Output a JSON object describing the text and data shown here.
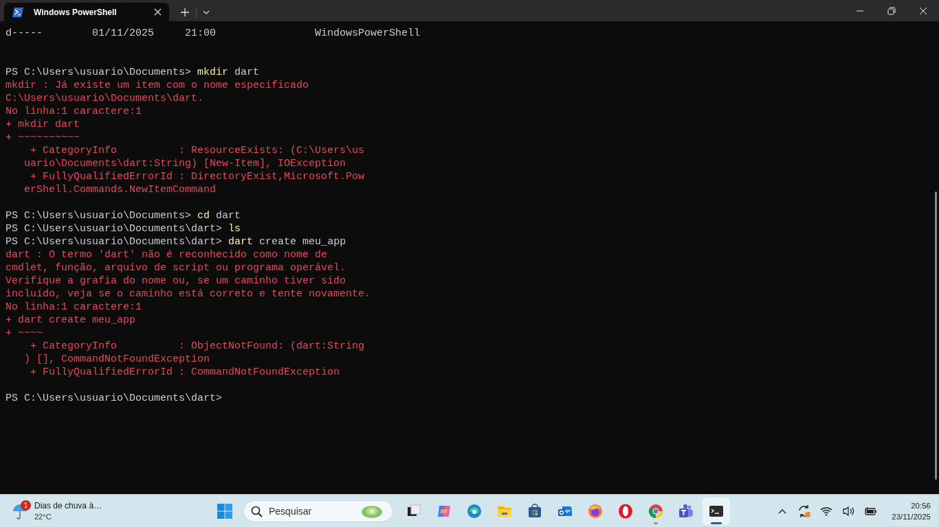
{
  "window": {
    "tabs": [
      {
        "title": "Windows PowerShell",
        "selected": true
      }
    ]
  },
  "terminal": {
    "lines": [
      {
        "kind": "output",
        "text": "d-----        01/11/2025     21:00                WindowsPowerShell"
      },
      {
        "kind": "blank"
      },
      {
        "kind": "blank"
      },
      {
        "kind": "prompt",
        "prompt": "PS C:\\Users\\usuario\\Documents>",
        "command": "mkdir",
        "args": "dart"
      },
      {
        "kind": "error",
        "text": "mkdir : Já existe um item com o nome especificado"
      },
      {
        "kind": "error",
        "text": "C:\\Users\\usuario\\Documents\\dart."
      },
      {
        "kind": "error",
        "text": "No linha:1 caractere:1"
      },
      {
        "kind": "error",
        "text": "+ mkdir dart"
      },
      {
        "kind": "error",
        "text": "+ ~~~~~~~~~~"
      },
      {
        "kind": "error",
        "text": "    + CategoryInfo          : ResourceExists: (C:\\Users\\us"
      },
      {
        "kind": "error",
        "text": "   uario\\Documents\\dart:String) [New-Item], IOException"
      },
      {
        "kind": "error",
        "text": "    + FullyQualifiedErrorId : DirectoryExist,Microsoft.Pow"
      },
      {
        "kind": "error",
        "text": "   erShell.Commands.NewItemCommand"
      },
      {
        "kind": "blank"
      },
      {
        "kind": "prompt",
        "prompt": "PS C:\\Users\\usuario\\Documents>",
        "command": "cd",
        "args": "dart"
      },
      {
        "kind": "prompt",
        "prompt": "PS C:\\Users\\usuario\\Documents\\dart>",
        "command": "ls"
      },
      {
        "kind": "prompt",
        "prompt": "PS C:\\Users\\usuario\\Documents\\dart>",
        "command": "dart",
        "args": "create meu_app"
      },
      {
        "kind": "error",
        "text": "dart : O termo 'dart' não é reconhecido como nome de"
      },
      {
        "kind": "error",
        "text": "cmdlet, função, arquivo de script ou programa operável."
      },
      {
        "kind": "error",
        "text": "Verifique a grafia do nome ou, se um caminho tiver sido"
      },
      {
        "kind": "error",
        "text": "incluído, veja se o caminho está correto e tente novamente."
      },
      {
        "kind": "error",
        "text": "No linha:1 caractere:1"
      },
      {
        "kind": "error",
        "text": "+ dart create meu_app"
      },
      {
        "kind": "error",
        "text": "+ ~~~~"
      },
      {
        "kind": "error",
        "text": "    + CategoryInfo          : ObjectNotFound: (dart:String"
      },
      {
        "kind": "error",
        "text": "   ) [], CommandNotFoundException"
      },
      {
        "kind": "error",
        "text": "    + FullyQualifiedErrorId : CommandNotFoundException"
      },
      {
        "kind": "blank"
      },
      {
        "kind": "prompt",
        "prompt": "PS C:\\Users\\usuario\\Documents\\dart>"
      }
    ]
  },
  "taskbar": {
    "weather": {
      "badge": "1",
      "text": "Dias de chuva à…",
      "temperature": "22°C"
    },
    "search": {
      "placeholder": "Pesquisar"
    },
    "apps": [
      {
        "kind": "taskview",
        "running": false,
        "selected": false
      },
      {
        "kind": "copilot",
        "running": false,
        "selected": false
      },
      {
        "kind": "edge",
        "running": false,
        "selected": false
      },
      {
        "kind": "explorer",
        "running": false,
        "selected": false
      },
      {
        "kind": "store",
        "running": false,
        "selected": false
      },
      {
        "kind": "outlook",
        "running": false,
        "selected": false
      },
      {
        "kind": "firefox",
        "running": false,
        "selected": false
      },
      {
        "kind": "opera",
        "running": false,
        "selected": false
      },
      {
        "kind": "chrome",
        "running": true,
        "selected": false
      },
      {
        "kind": "teams",
        "running": false,
        "selected": false
      },
      {
        "kind": "terminal",
        "running": true,
        "selected": true
      }
    ],
    "clock": {
      "time": "20:56",
      "date": "23/11/2025"
    }
  }
}
